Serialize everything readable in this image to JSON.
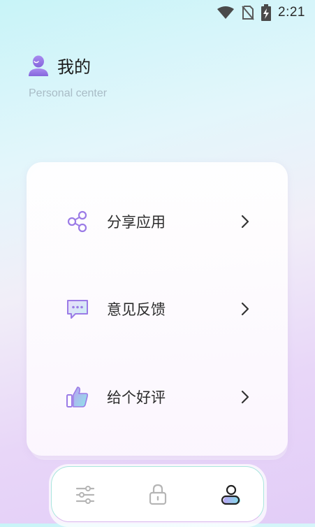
{
  "status_bar": {
    "time": "2:21",
    "icons": [
      "wifi-icon",
      "no-sim-icon",
      "battery-charging-icon"
    ]
  },
  "header": {
    "title": "我的",
    "subtitle": "Personal center",
    "icon": "user-avatar-icon"
  },
  "menu": {
    "items": [
      {
        "label": "分享应用",
        "icon": "share-icon"
      },
      {
        "label": "意见反馈",
        "icon": "feedback-chat-icon"
      },
      {
        "label": "给个好评",
        "icon": "thumbs-up-icon"
      }
    ]
  },
  "tab_bar": {
    "tabs": [
      {
        "icon": "sliders-icon",
        "active": false
      },
      {
        "icon": "lock-icon",
        "active": false
      },
      {
        "icon": "user-icon",
        "active": true
      }
    ]
  },
  "colors": {
    "accent_purple": "#9b7be6",
    "accent_teal": "#7fe0e8",
    "text_primary": "#2c2c2c",
    "subtitle": "#a9bcc6"
  }
}
